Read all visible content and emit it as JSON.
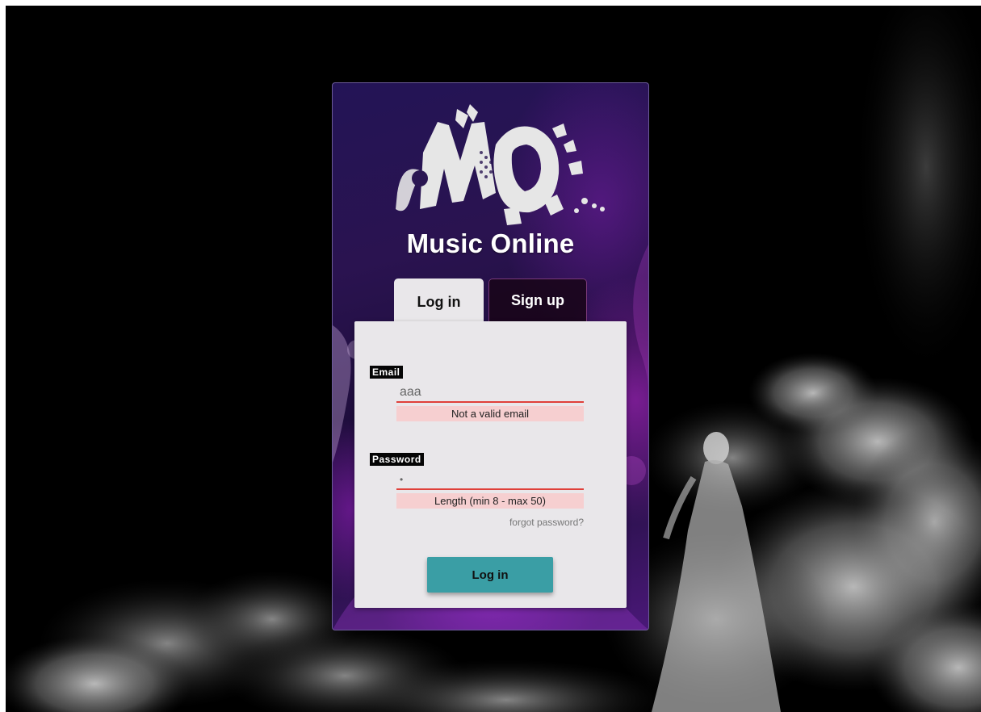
{
  "app": {
    "title": "Music Online",
    "logo_icon": "mo-grunge-logo-icon"
  },
  "tabs": [
    {
      "label": "Log in",
      "active": true
    },
    {
      "label": "Sign up",
      "active": false
    }
  ],
  "form": {
    "email": {
      "label": "Email",
      "value": "aaa",
      "error": "Not a valid email"
    },
    "password": {
      "label": "Password",
      "value": "•",
      "error": "Length (min 8 - max 50)"
    },
    "forgot_label": "forgot password?",
    "submit_label": "Log in"
  },
  "colors": {
    "accent": "#3a9ea5",
    "error_line": "#e0403a",
    "error_bg": "#f6cfd0",
    "card_purple": "#231456"
  }
}
